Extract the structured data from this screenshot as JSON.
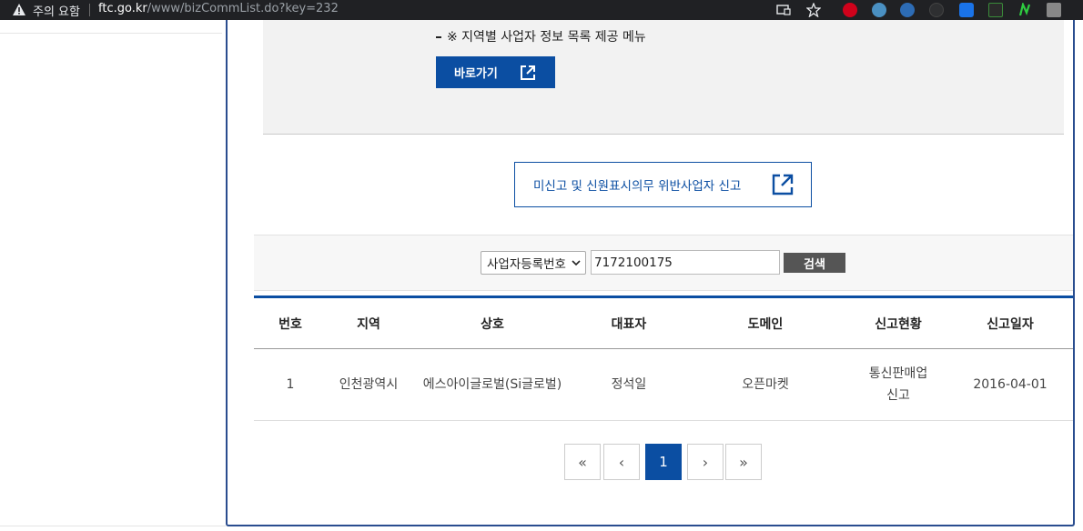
{
  "browser": {
    "security_label": "주의 요함",
    "url_domain": "ftc.go.kr",
    "url_path": "/www/bizCommList.do?key=232",
    "icons": [
      "warning-icon",
      "cast-icon",
      "bookmark-star-icon",
      "extension-icons"
    ]
  },
  "info": {
    "note": "※ 지역별 사업자 정보 목록 제공 메뉴",
    "go_button": "바로가기"
  },
  "report_button": "미신고 및 신원표시의무 위반사업자 신고",
  "search": {
    "select_value": "사업자등록번호",
    "input_value": "7172100175",
    "button": "검색"
  },
  "table": {
    "headers": [
      "번호",
      "지역",
      "상호",
      "대표자",
      "도메인",
      "신고현황",
      "신고일자"
    ],
    "rows": [
      [
        "1",
        "인천광역시",
        "에스아이글로벌(Si글로벌)",
        "정석일",
        "오픈마켓",
        "통신판매업\n신고",
        "2016-04-01"
      ]
    ]
  },
  "pagination": {
    "first": "«",
    "prev": "‹",
    "current": "1",
    "next": "›",
    "last": "»"
  },
  "colors": {
    "accent": "#0b4ea2",
    "frame_border": "#2a4d8f",
    "search_button": "#555555",
    "browser_bar": "#202124"
  }
}
